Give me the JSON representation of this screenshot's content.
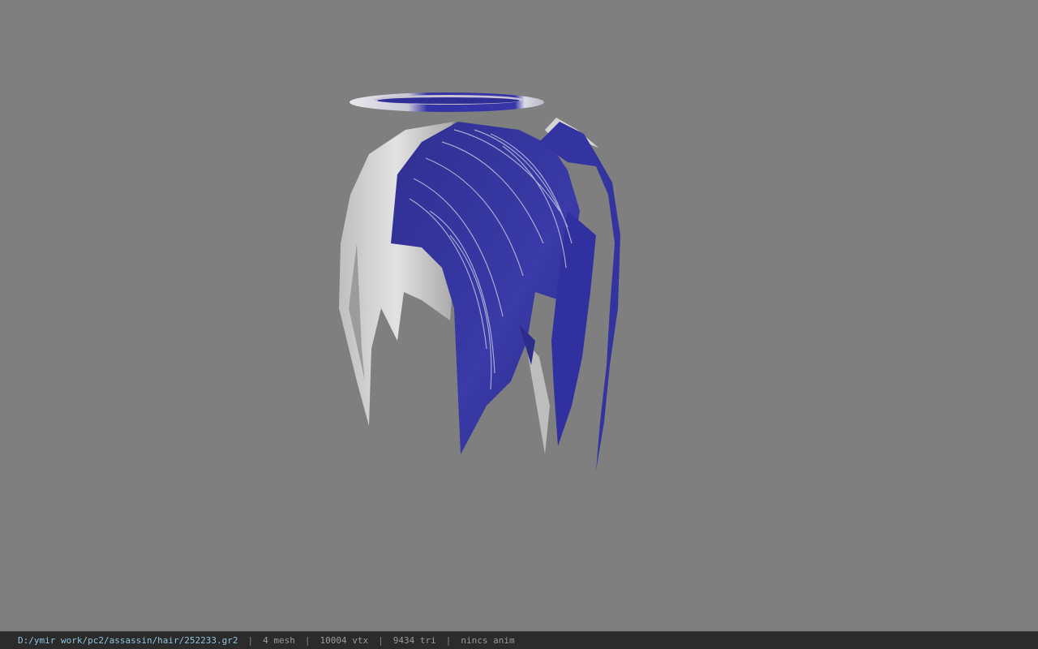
{
  "viewport": {
    "background_color": "#7f7f7f",
    "model_colors": {
      "hair_blue": "#3a3aa0",
      "hair_white": "#d8d8d8",
      "halo_blue": "#3434a6",
      "halo_white": "#e6e6ec"
    }
  },
  "status_bar": {
    "file_path": "D:/ymir work/pc2/assassin/hair/252233.gr2",
    "separator": "|",
    "mesh_count": "4 mesh",
    "vertex_count": "10004 vtx",
    "triangle_count": "9434 tri",
    "animation_status": "nincs anim"
  }
}
